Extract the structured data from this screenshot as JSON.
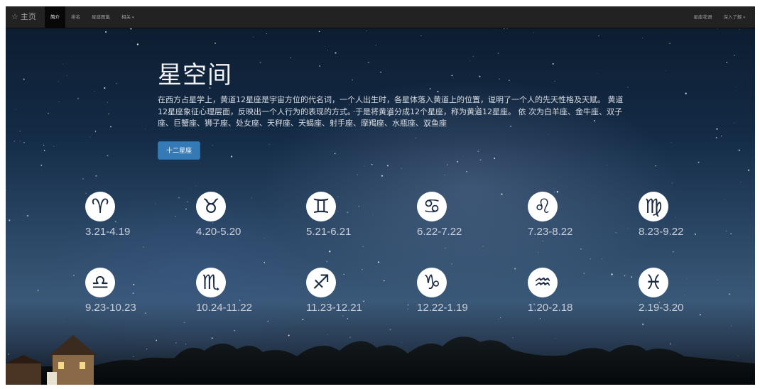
{
  "navbar": {
    "brand": "主页",
    "left_items": [
      {
        "label": "简介",
        "active": true
      },
      {
        "label": "排名",
        "active": false
      },
      {
        "label": "星座图集",
        "active": false
      },
      {
        "label": "相关",
        "active": false,
        "dropdown": true
      }
    ],
    "right_items": [
      {
        "label": "星座花语",
        "dropdown": false
      },
      {
        "label": "深入了解",
        "dropdown": true
      }
    ]
  },
  "hero": {
    "title": "星空间",
    "description": "在西方占星学上，黄道12星座是宇宙方位的代名词，一个人出生时，各星体落入黄道上的位置，说明了一个人的先天性格及天赋。 黄道12星座象征心理层面，反映出一个人行为的表现的方式。于是将黄道分成12个星座，称为黄道12星座。 依 次为白羊座、金牛座、双子座、巨蟹座、狮子座、处女座、天秤座、天蝎座、射手座、摩羯座、水瓶座、双鱼座",
    "button_label": "十二星座"
  },
  "zodiac": [
    {
      "symbol": "♈",
      "icon": "aries-icon",
      "dates": "3.21-4.19"
    },
    {
      "symbol": "♉",
      "icon": "taurus-icon",
      "dates": "4.20-5.20"
    },
    {
      "symbol": "♊",
      "icon": "gemini-icon",
      "dates": "5.21-6.21"
    },
    {
      "symbol": "♋",
      "icon": "cancer-icon",
      "dates": "6.22-7.22"
    },
    {
      "symbol": "♌",
      "icon": "leo-icon",
      "dates": "7.23-8.22"
    },
    {
      "symbol": "♍",
      "icon": "virgo-icon",
      "dates": "8.23-9.22"
    },
    {
      "symbol": "♎",
      "icon": "libra-icon",
      "dates": "9.23-10.23"
    },
    {
      "symbol": "♏",
      "icon": "scorpio-icon",
      "dates": "10.24-11.22"
    },
    {
      "symbol": "♐",
      "icon": "sagittarius-icon",
      "dates": "11.23-12.21"
    },
    {
      "symbol": "♑",
      "icon": "capricorn-icon",
      "dates": "12.22-1.19"
    },
    {
      "symbol": "♒",
      "icon": "aquarius-icon",
      "dates": "1.20-2.18"
    },
    {
      "symbol": "♓",
      "icon": "pisces-icon",
      "dates": "2.19-3.20"
    }
  ],
  "colors": {
    "navbar_bg": "#222222",
    "active_nav_bg": "#080808",
    "primary_button": "#337ab7",
    "sky_top": "#0b1a2c",
    "sky_horizon": "#3a5878"
  }
}
